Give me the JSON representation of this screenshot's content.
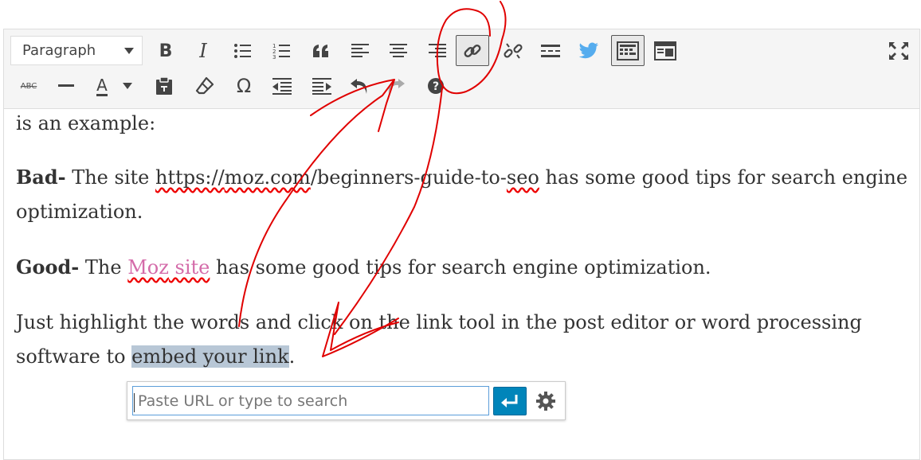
{
  "toolbar": {
    "format_select": {
      "value": "Paragraph"
    },
    "row1": [
      {
        "name": "bold-icon",
        "label": "B"
      },
      {
        "name": "italic-icon",
        "label": "I"
      },
      {
        "name": "bulleted-list-icon"
      },
      {
        "name": "numbered-list-icon"
      },
      {
        "name": "blockquote-icon"
      },
      {
        "name": "align-left-icon"
      },
      {
        "name": "align-center-icon"
      },
      {
        "name": "align-right-icon"
      },
      {
        "name": "insert-link-icon",
        "active": true
      },
      {
        "name": "remove-link-icon"
      },
      {
        "name": "read-more-icon"
      },
      {
        "name": "twitter-icon"
      },
      {
        "name": "toolbar-toggle-icon",
        "active": true
      },
      {
        "name": "distraction-free-icon"
      },
      {
        "name": "fullscreen-icon"
      }
    ],
    "row2": [
      {
        "name": "strikethrough-icon",
        "label": "ABC"
      },
      {
        "name": "horizontal-line-icon"
      },
      {
        "name": "text-color-icon",
        "label": "A"
      },
      {
        "name": "paste-as-text-icon"
      },
      {
        "name": "clear-formatting-icon"
      },
      {
        "name": "special-character-icon",
        "label": "Ω"
      },
      {
        "name": "decrease-indent-icon"
      },
      {
        "name": "increase-indent-icon"
      },
      {
        "name": "undo-icon"
      },
      {
        "name": "redo-icon"
      },
      {
        "name": "help-icon"
      }
    ]
  },
  "content": {
    "p1": "is an example:",
    "p2": {
      "bold": "Bad-",
      "t1": " The site ",
      "url_a": "https://",
      "url_b": "moz.com",
      "url_c": "/beginners-guide-to-",
      "url_d": "seo",
      "t2": " has some good tips for search engine",
      "t3": "optimization."
    },
    "p3": {
      "bold": "Good-",
      "t1": " The ",
      "link1": "Moz",
      "link2": " site",
      "t2": " has some good tips for search engine optimization."
    },
    "p4": {
      "t1": "Just highlight the words and click on the link tool in the post editor or word processing",
      "t2": "software to ",
      "selected": "embed your link",
      "t3": "."
    }
  },
  "link_popup": {
    "placeholder": "Paste URL or type to search",
    "value": ""
  },
  "colors": {
    "toolbar_bg": "#f5f5f5",
    "link": "#d46ba9",
    "apply_button": "#0085ba",
    "annotation": "#e00000",
    "twitter": "#55acee"
  }
}
